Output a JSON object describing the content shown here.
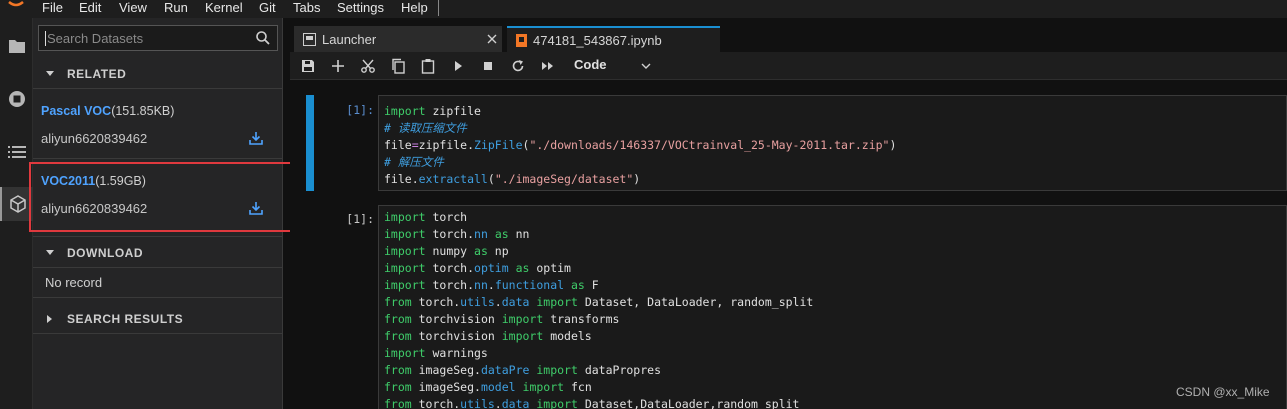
{
  "menu": [
    "File",
    "Edit",
    "View",
    "Run",
    "Kernel",
    "Git",
    "Tabs",
    "Settings",
    "Help"
  ],
  "sidebar": {
    "search_placeholder": "Search Datasets",
    "related_header": "RELATED",
    "datasets": [
      {
        "name": "Pascal VOC",
        "size": "(151.85KB)",
        "owner": "aliyun6620839462"
      },
      {
        "name": "VOC2011",
        "size": "(1.59GB)",
        "owner": "aliyun6620839462"
      }
    ],
    "download_header": "DOWNLOAD",
    "no_record": "No record",
    "search_results_header": "SEARCH RESULTS"
  },
  "tabs": [
    {
      "label": "Launcher"
    },
    {
      "label": "474181_543867.ipynb"
    }
  ],
  "toolbar": {
    "cell_type": "Code"
  },
  "cells": [
    {
      "prompt": "[1]:",
      "lines": [
        "import zipfile",
        "# 读取压缩文件",
        "file=zipfile.ZipFile(\"./downloads/146337/VOCtrainval_25-May-2011.tar.zip\")",
        "# 解压文件",
        "file.extractall(\"./imageSeg/dataset\")"
      ]
    },
    {
      "prompt": "[1]:",
      "lines": [
        "import torch",
        "import torch.nn as nn",
        "import numpy as np",
        "import torch.optim as optim",
        "import torch.nn.functional as F",
        "from torch.utils.data import Dataset, DataLoader, random_split",
        "from torchvision import transforms",
        "from torchvision import models",
        "import warnings",
        "from imageSeg.dataPre import dataPropres",
        "from imageSeg.model import fcn",
        "from torch.utils.data import Dataset,DataLoader,random_split"
      ]
    }
  ],
  "watermark": "CSDN @xx_Mike",
  "colors": {
    "accent": "#1a8fd1",
    "link": "#4fa3ff",
    "highlight": "#e0393e",
    "keyword": "#3fcd6a",
    "string": "#e8a0a0"
  }
}
